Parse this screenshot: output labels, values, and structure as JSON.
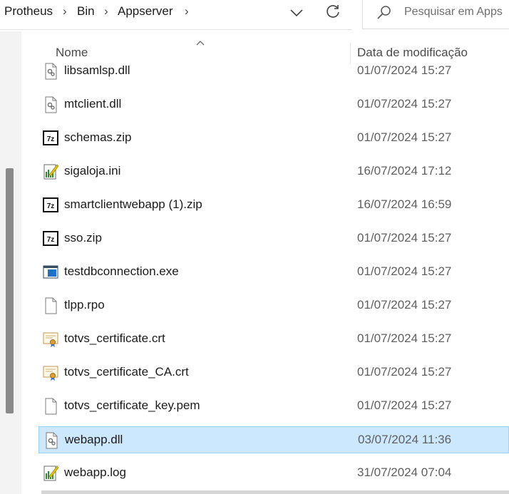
{
  "address": {
    "breadcrumbs": [
      "Protheus",
      "Bin",
      "Appserver"
    ],
    "separator": "›"
  },
  "search": {
    "placeholder": "Pesquisar em Apps"
  },
  "columns": {
    "name": "Nome",
    "date": "Data de modificação"
  },
  "files": [
    {
      "name": "libsamlsp.dll",
      "date": "01/07/2024 15:27",
      "icon": "dll-icon",
      "selected": false
    },
    {
      "name": "mtclient.dll",
      "date": "01/07/2024 15:27",
      "icon": "dll-icon",
      "selected": false
    },
    {
      "name": "schemas.zip",
      "date": "01/07/2024 15:27",
      "icon": "7z-archive-icon",
      "selected": false
    },
    {
      "name": "sigaloja.ini",
      "date": "16/07/2024 17:12",
      "icon": "ini-file-icon",
      "selected": false
    },
    {
      "name": "smartclientwebapp (1).zip",
      "date": "16/07/2024 16:59",
      "icon": "7z-archive-icon",
      "selected": false
    },
    {
      "name": "sso.zip",
      "date": "01/07/2024 15:27",
      "icon": "7z-archive-icon",
      "selected": false
    },
    {
      "name": "testdbconnection.exe",
      "date": "01/07/2024 15:27",
      "icon": "exe-icon",
      "selected": false
    },
    {
      "name": "tlpp.rpo",
      "date": "01/07/2024 15:27",
      "icon": "blank-file-icon",
      "selected": false
    },
    {
      "name": "totvs_certificate.crt",
      "date": "01/07/2024 15:27",
      "icon": "certificate-icon",
      "selected": false
    },
    {
      "name": "totvs_certificate_CA.crt",
      "date": "01/07/2024 15:27",
      "icon": "certificate-icon",
      "selected": false
    },
    {
      "name": "totvs_certificate_key.pem",
      "date": "01/07/2024 15:27",
      "icon": "blank-file-icon",
      "selected": false
    },
    {
      "name": "webapp.dll",
      "date": "03/07/2024 11:36",
      "icon": "dll-icon",
      "selected": true
    },
    {
      "name": "webapp.log",
      "date": "31/07/2024 07:04",
      "icon": "log-file-icon",
      "selected": false
    }
  ],
  "colors": {
    "selection_bg": "#cce8ff",
    "selection_border": "#99d1ff",
    "text": "#1b1b1b",
    "date_text": "#5f5f5f"
  }
}
